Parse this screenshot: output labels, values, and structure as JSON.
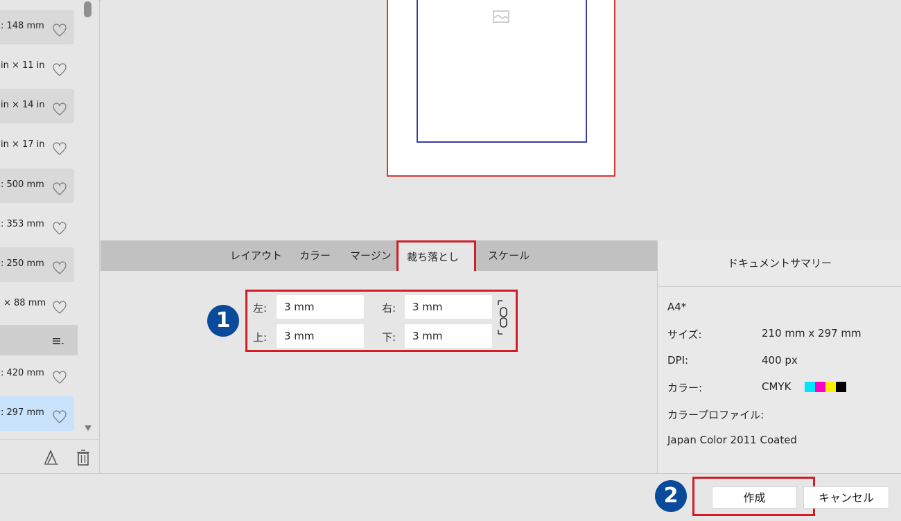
{
  "sidebar": {
    "presets": [
      {
        "label": ": 148 mm",
        "state": "shaded"
      },
      {
        "label": "in × 11 in",
        "state": "normal"
      },
      {
        "label": "in × 14 in",
        "state": "shaded"
      },
      {
        "label": "in × 17 in",
        "state": "normal"
      },
      {
        "label": ": 500 mm",
        "state": "shaded"
      },
      {
        "label": ": 353 mm",
        "state": "normal"
      },
      {
        "label": ": 250 mm",
        "state": "shaded"
      },
      {
        "label": "× 88 mm",
        "state": "normal"
      },
      {
        "label": ": 420 mm",
        "state": "normal"
      },
      {
        "label": ": 297 mm",
        "state": "selected"
      }
    ]
  },
  "tabs": [
    {
      "label": "レイアウト"
    },
    {
      "label": "カラー"
    },
    {
      "label": "マージン"
    },
    {
      "label": "裁ち落とし"
    },
    {
      "label": "スケール"
    }
  ],
  "bleed": {
    "left_label": "左:",
    "left_value": "3 mm",
    "right_label": "右:",
    "right_value": "3 mm",
    "top_label": "上:",
    "top_value": "3 mm",
    "bottom_label": "下:",
    "bottom_value": "3 mm"
  },
  "badges": {
    "one": "1",
    "two": "2"
  },
  "summary": {
    "title": "ドキュメントサマリー",
    "preset_name": "A4*",
    "size_label": "サイズ:",
    "size_value": "210 mm  x  297 mm",
    "dpi_label": "DPI:",
    "dpi_value": "400 px",
    "color_label": "カラー:",
    "color_value": "CMYK",
    "profile_label": "カラープロファイル:",
    "profile_value": "Japan Color 2011 Coated",
    "swatch_colors": [
      "#00e5ff",
      "#ff00c8",
      "#ffee00",
      "#000000"
    ]
  },
  "buttons": {
    "create": "作成",
    "cancel": "キャンセル"
  },
  "colors": {
    "highlight_red": "#d31d26",
    "badge_blue": "#0a4a9b",
    "bleed_line": "#d43a3a",
    "page_line": "#3c3ca8",
    "selected_row": "#c9e2fb"
  }
}
